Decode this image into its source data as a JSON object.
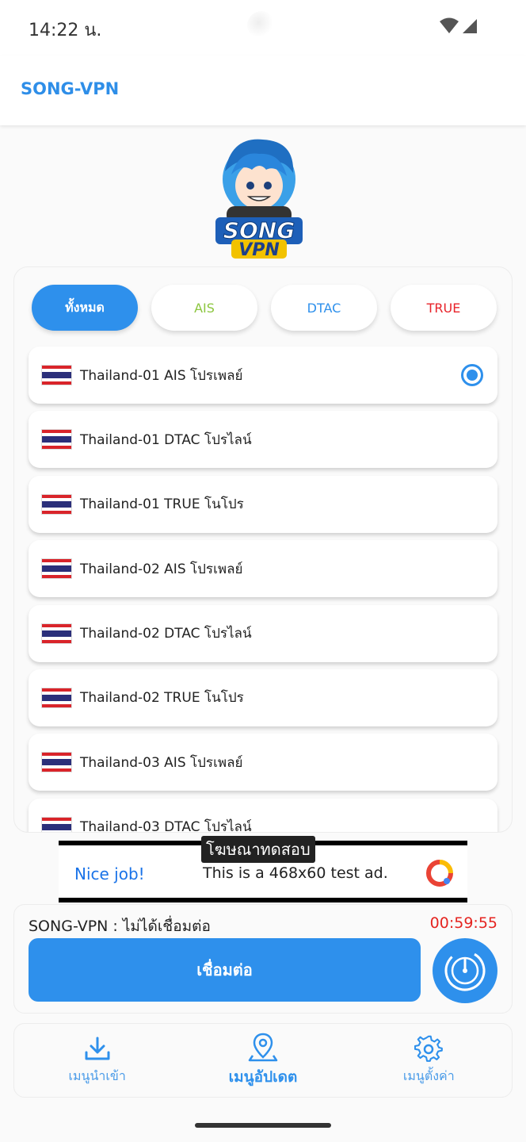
{
  "status_bar": {
    "time": "14:22 น."
  },
  "app_bar": {
    "title": "SONG-VPN"
  },
  "logo": {
    "text_top": "SONG",
    "text_bottom": "VPN"
  },
  "filters": [
    {
      "label": "ทั้งหมด",
      "active": true
    },
    {
      "label": "AIS",
      "active": false
    },
    {
      "label": "DTAC",
      "active": false
    },
    {
      "label": "TRUE",
      "active": false
    }
  ],
  "servers": [
    {
      "label": "Thailand-01 AIS โปรเพลย์",
      "selected": true
    },
    {
      "label": "Thailand-01 DTAC โปรไลน์",
      "selected": false
    },
    {
      "label": "Thailand-01 TRUE โนโปร",
      "selected": false
    },
    {
      "label": "Thailand-02 AIS โปรเพลย์",
      "selected": false
    },
    {
      "label": "Thailand-02 DTAC โปรไลน์",
      "selected": false
    },
    {
      "label": "Thailand-02 TRUE โนโปร",
      "selected": false
    },
    {
      "label": "Thailand-03 AIS โปรเพลย์",
      "selected": false
    },
    {
      "label": "Thailand-03 DTAC โปรไลน์",
      "selected": false
    }
  ],
  "ad": {
    "tag": "โฆษณาทดสอบ",
    "headline": "Nice job!",
    "message": "This is a 468x60 test ad."
  },
  "connection": {
    "status": "SONG-VPN : ไม่ได้เชื่อมต่อ",
    "timer": "00:59:55",
    "connect_label": "เชื่อมต่อ"
  },
  "nav": {
    "import_label": "เมนูนำเข้า",
    "update_label": "เมนูอัปเดต",
    "settings_label": "เมนูตั้งค่า"
  },
  "colors": {
    "accent": "#2e90ec",
    "ais": "#8cc63f",
    "dtac": "#2e90ec",
    "true": "#e8232a",
    "timer": "#e52420"
  }
}
